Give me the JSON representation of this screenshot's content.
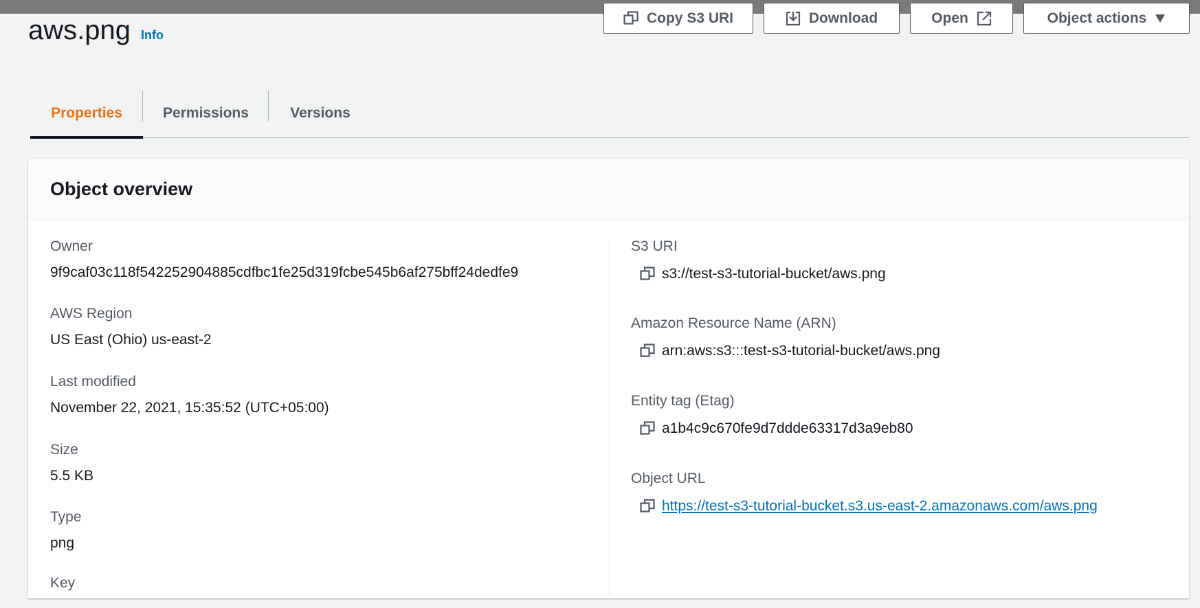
{
  "header": {
    "title": "aws.png",
    "info_label": "Info"
  },
  "actions": {
    "copy_s3_uri": "Copy S3 URI",
    "download": "Download",
    "open": "Open",
    "object_actions": "Object actions"
  },
  "tabs": [
    {
      "label": "Properties",
      "active": true
    },
    {
      "label": "Permissions",
      "active": false
    },
    {
      "label": "Versions",
      "active": false
    }
  ],
  "overview": {
    "title": "Object overview",
    "left": [
      {
        "label": "Owner",
        "value": "9f9caf03c118f542252904885cdfbc1fe25d319fcbe545b6af275bff24dedfe9"
      },
      {
        "label": "AWS Region",
        "value": "US East (Ohio) us-east-2"
      },
      {
        "label": "Last modified",
        "value": "November 22, 2021, 15:35:52 (UTC+05:00)"
      },
      {
        "label": "Size",
        "value": "5.5 KB"
      },
      {
        "label": "Type",
        "value": "png"
      },
      {
        "label": "Key",
        "value": ""
      }
    ],
    "right": [
      {
        "label": "S3 URI",
        "value": "s3://test-s3-tutorial-bucket/aws.png"
      },
      {
        "label": "Amazon Resource Name (ARN)",
        "value": "arn:aws:s3:::test-s3-tutorial-bucket/aws.png"
      },
      {
        "label": "Entity tag (Etag)",
        "value": "a1b4c9c670fe9d7ddde63317d3a9eb80"
      },
      {
        "label": "Object URL",
        "value": "https://test-s3-tutorial-bucket.s3.us-east-2.amazonaws.com/aws.png"
      }
    ]
  },
  "colors": {
    "accent_tab": "#ec7211",
    "link": "#0073bb",
    "text": "#16191f",
    "muted": "#545b64"
  },
  "icons": [
    "copy-icon",
    "download-icon",
    "external-link-icon",
    "caret-down-icon"
  ]
}
